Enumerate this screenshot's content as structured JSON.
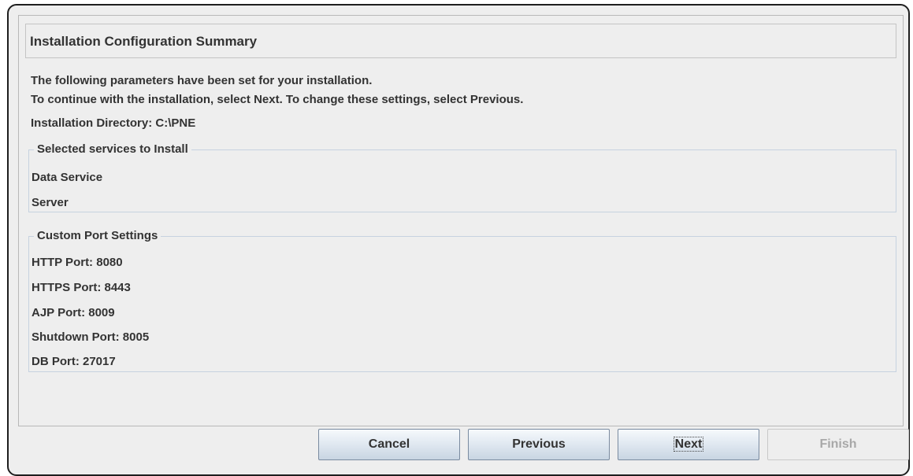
{
  "dialog": {
    "title": "Installation Configuration Summary",
    "intro_line1": "The following parameters have been set for your installation.",
    "intro_line2": "To continue with the installation, select Next. To change these settings, select Previous.",
    "install_directory": "Installation Directory: C:\\PNE"
  },
  "services": {
    "legend": "Selected services to Install",
    "items": [
      "Data Service",
      "Server"
    ]
  },
  "ports": {
    "legend": "Custom Port Settings",
    "items": [
      "HTTP Port: 8080",
      "HTTPS Port: 8443",
      "AJP Port: 8009",
      "Shutdown Port: 8005",
      "DB Port: 27017"
    ]
  },
  "buttons": {
    "cancel": "Cancel",
    "previous": "Previous",
    "next": "Next",
    "finish": "Finish"
  },
  "colors": {
    "window_bg": "#eeeeee",
    "group_border": "#c6d2e0",
    "button_border": "#7a8ba0",
    "disabled_text": "#a8a8a8"
  }
}
